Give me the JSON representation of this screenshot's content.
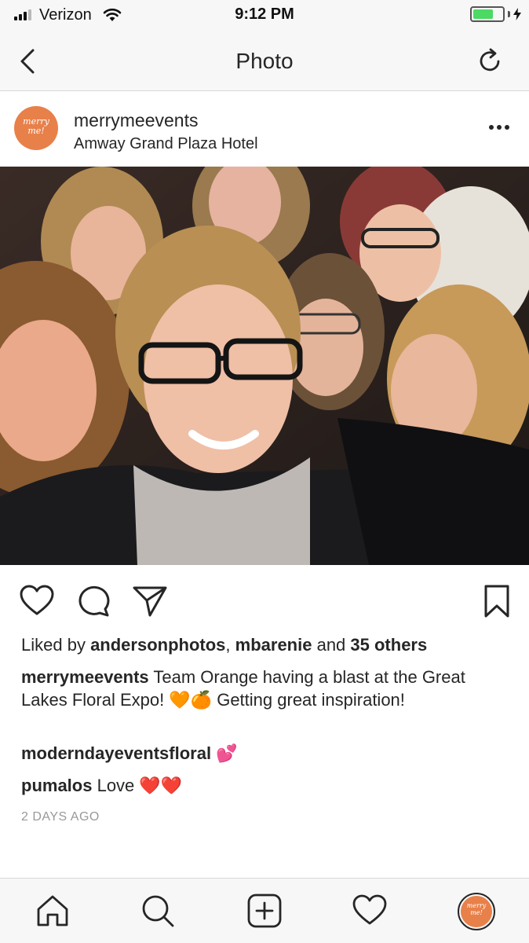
{
  "status_bar": {
    "carrier": "Verizon",
    "time": "9:12 PM",
    "battery_level": 0.7
  },
  "nav": {
    "title": "Photo"
  },
  "post": {
    "username": "merrymeevents",
    "location": "Amway Grand Plaza Hotel",
    "avatar_text": "merry me!"
  },
  "likes": {
    "prefix": "Liked by ",
    "user1": "andersonphotos",
    "sep": ", ",
    "user2": "mbarenie",
    "and": " and ",
    "others": "35 others"
  },
  "caption": {
    "username": "merrymeevents",
    "text": " Team Orange having a blast at the Great Lakes Floral Expo! 🧡🍊 Getting great inspiration!"
  },
  "comments": [
    {
      "username": "moderndayeventsfloral",
      "text": " 💕"
    },
    {
      "username": "pumalos",
      "text": " Love ❤️❤️"
    }
  ],
  "timestamp": "2 DAYS AGO",
  "colors": {
    "brand_orange": "#e8804a",
    "battery_green": "#4cd964",
    "text": "#262626",
    "muted": "#999999"
  },
  "icons": [
    "back-icon",
    "refresh-icon",
    "more-icon",
    "heart-icon",
    "comment-icon",
    "share-icon",
    "bookmark-icon",
    "home-icon",
    "search-icon",
    "add-icon",
    "activity-icon",
    "profile-avatar"
  ]
}
